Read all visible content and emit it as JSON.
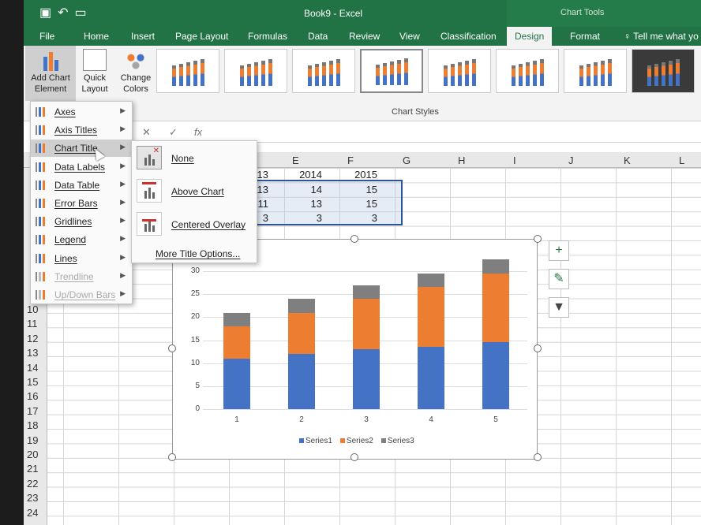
{
  "window": {
    "title": "Book9 - Excel",
    "context_title": "Chart Tools",
    "accent": "#217346"
  },
  "tabs": [
    {
      "label": "File"
    },
    {
      "label": "Home"
    },
    {
      "label": "Insert"
    },
    {
      "label": "Page Layout"
    },
    {
      "label": "Formulas"
    },
    {
      "label": "Data"
    },
    {
      "label": "Review"
    },
    {
      "label": "View"
    },
    {
      "label": "Classification"
    },
    {
      "label": "Design"
    },
    {
      "label": "Format"
    }
  ],
  "tell_me": "Tell me what yo",
  "ribbon": {
    "add_chart_element": "Add Chart Element",
    "quick_layout": "Quick Layout",
    "change_colors": "Change Colors",
    "group_chart_styles": "Chart Styles"
  },
  "formula_bar": {
    "fx": "fx"
  },
  "columns": [
    "E",
    "F",
    "G",
    "H",
    "I",
    "J",
    "K",
    "L"
  ],
  "rows": [
    "10",
    "11",
    "12",
    "13",
    "14",
    "15",
    "16",
    "17",
    "18",
    "19",
    "20",
    "21",
    "22",
    "23",
    "24"
  ],
  "cells": {
    "d1": "13",
    "e1": "2014",
    "f1": "2015",
    "d2": "13",
    "e2": "14",
    "f2": "15",
    "d3": "11",
    "e3": "13",
    "f3": "15",
    "d4": "3",
    "e4": "3",
    "f4": "3"
  },
  "add_chart_menu": [
    {
      "label": "Axes",
      "disabled": false
    },
    {
      "label": "Axis Titles",
      "disabled": false
    },
    {
      "label": "Chart Title",
      "disabled": false
    },
    {
      "label": "Data Labels",
      "disabled": false
    },
    {
      "label": "Data Table",
      "disabled": false
    },
    {
      "label": "Error Bars",
      "disabled": false
    },
    {
      "label": "Gridlines",
      "disabled": false
    },
    {
      "label": "Legend",
      "disabled": false
    },
    {
      "label": "Lines",
      "disabled": false
    },
    {
      "label": "Trendline",
      "disabled": true
    },
    {
      "label": "Up/Down Bars",
      "disabled": true
    }
  ],
  "chart_title_submenu": {
    "items": [
      {
        "label": "None"
      },
      {
        "label": "Above Chart"
      },
      {
        "label": "Centered Overlay"
      }
    ],
    "more": "More Title Options..."
  },
  "chart_data": {
    "type": "bar",
    "stacked": true,
    "categories": [
      "1",
      "2",
      "3",
      "4",
      "5"
    ],
    "series": [
      {
        "name": "Series1",
        "color": "#4472c4",
        "values": [
          11,
          12,
          13,
          13.5,
          14.5
        ]
      },
      {
        "name": "Series2",
        "color": "#ed7d31",
        "values": [
          7,
          9,
          11,
          13,
          15
        ]
      },
      {
        "name": "Series3",
        "color": "#7f7f7f",
        "values": [
          3,
          3,
          3,
          3,
          3
        ]
      }
    ],
    "ylim": [
      0,
      30
    ],
    "yticks": [
      "0",
      "5",
      "10",
      "15",
      "20",
      "25",
      "30"
    ],
    "grid": true,
    "legend": "bottom"
  }
}
